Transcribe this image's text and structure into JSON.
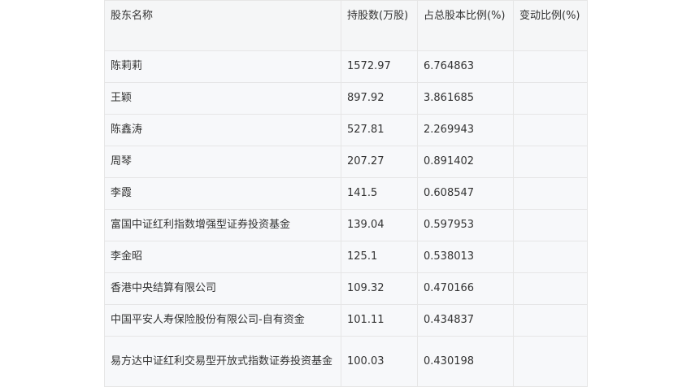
{
  "table": {
    "headers": [
      "股东名称",
      "持股数(万股)",
      "占总股本比例(%)",
      "变动比例(%)"
    ],
    "rows": [
      {
        "name": "陈莉莉",
        "shares": "1572.97",
        "ratio": "6.764863",
        "change": ""
      },
      {
        "name": "王颖",
        "shares": "897.92",
        "ratio": "3.861685",
        "change": ""
      },
      {
        "name": "陈鑫涛",
        "shares": "527.81",
        "ratio": "2.269943",
        "change": ""
      },
      {
        "name": "周琴",
        "shares": "207.27",
        "ratio": "0.891402",
        "change": ""
      },
      {
        "name": "李霞",
        "shares": "141.5",
        "ratio": "0.608547",
        "change": ""
      },
      {
        "name": "富国中证红利指数增强型证券投资基金",
        "shares": "139.04",
        "ratio": "0.597953",
        "change": ""
      },
      {
        "name": "李金昭",
        "shares": "125.1",
        "ratio": "0.538013",
        "change": ""
      },
      {
        "name": "香港中央结算有限公司",
        "shares": "109.32",
        "ratio": "0.470166",
        "change": ""
      },
      {
        "name": "中国平安人寿保险股份有限公司-自有资金",
        "shares": "101.11",
        "ratio": "0.434837",
        "change": ""
      },
      {
        "name": "易方达中证红利交易型开放式指数证券投资基金",
        "shares": "100.03",
        "ratio": "0.430198",
        "change": ""
      }
    ]
  }
}
